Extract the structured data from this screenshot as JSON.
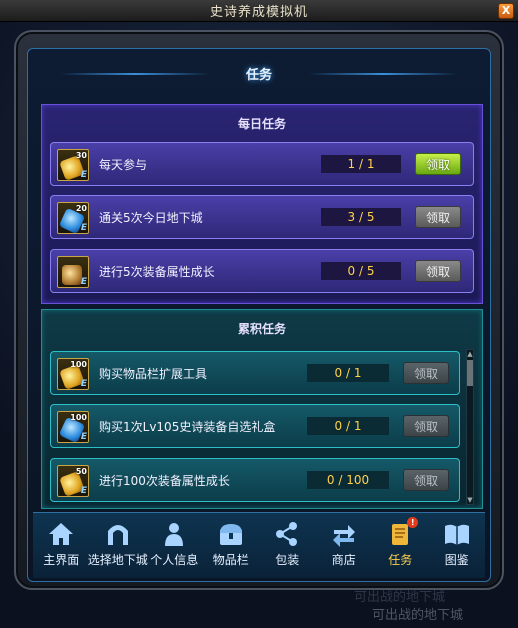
{
  "window": {
    "title": "史诗养成模拟机",
    "close_label": "X"
  },
  "page": {
    "title": "任务"
  },
  "daily": {
    "title": "每日任务",
    "tasks": [
      {
        "name": "每天参与",
        "icon": "gold-gem-icon",
        "badge": "30",
        "tag": "E",
        "progress": "1 / 1",
        "button": "领取",
        "state": "active"
      },
      {
        "name": "通关5次今日地下城",
        "icon": "blue-gem-icon",
        "badge": "20",
        "tag": "E",
        "progress": "3 / 5",
        "button": "领取",
        "state": "inactive"
      },
      {
        "name": "进行5次装备属性成长",
        "icon": "armor-icon",
        "badge": "",
        "tag": "E",
        "progress": "0 / 5",
        "button": "领取",
        "state": "inactive"
      }
    ]
  },
  "cumulative": {
    "title": "累积任务",
    "tasks": [
      {
        "name": "购买物品栏扩展工具",
        "icon": "gold-gem-icon",
        "badge": "100",
        "tag": "E",
        "progress": "0 / 1",
        "button": "领取",
        "state": "dim"
      },
      {
        "name": "购买1次Lv105史诗装备自选礼盒",
        "icon": "blue-gem-icon",
        "badge": "100",
        "tag": "E",
        "progress": "0 / 1",
        "button": "领取",
        "state": "dim"
      },
      {
        "name": "进行100次装备属性成长",
        "icon": "gold-gem-icon",
        "badge": "50",
        "tag": "E",
        "progress": "0 / 100",
        "button": "领取",
        "state": "dim"
      }
    ]
  },
  "nav": [
    {
      "label": "主界面",
      "icon": "home-icon",
      "active": false
    },
    {
      "label": "选择地下城",
      "icon": "gate-icon",
      "active": false
    },
    {
      "label": "个人信息",
      "icon": "person-icon",
      "active": false
    },
    {
      "label": "物品栏",
      "icon": "chest-icon",
      "active": false
    },
    {
      "label": "包装",
      "icon": "share-icon",
      "active": false
    },
    {
      "label": "商店",
      "icon": "exchange-icon",
      "active": false
    },
    {
      "label": "任务",
      "icon": "scroll-icon",
      "active": true,
      "badge": "!"
    },
    {
      "label": "图鉴",
      "icon": "book-icon",
      "active": false
    }
  ],
  "footer": {
    "line1": "可出战的地下城",
    "line2": "可出战的地下城"
  },
  "colors": {
    "accent_active_button": "#8ccf22",
    "daily_panel": "#2a2472",
    "cumulative_panel": "#0e3a46",
    "progress_text": "#ffd24a"
  }
}
